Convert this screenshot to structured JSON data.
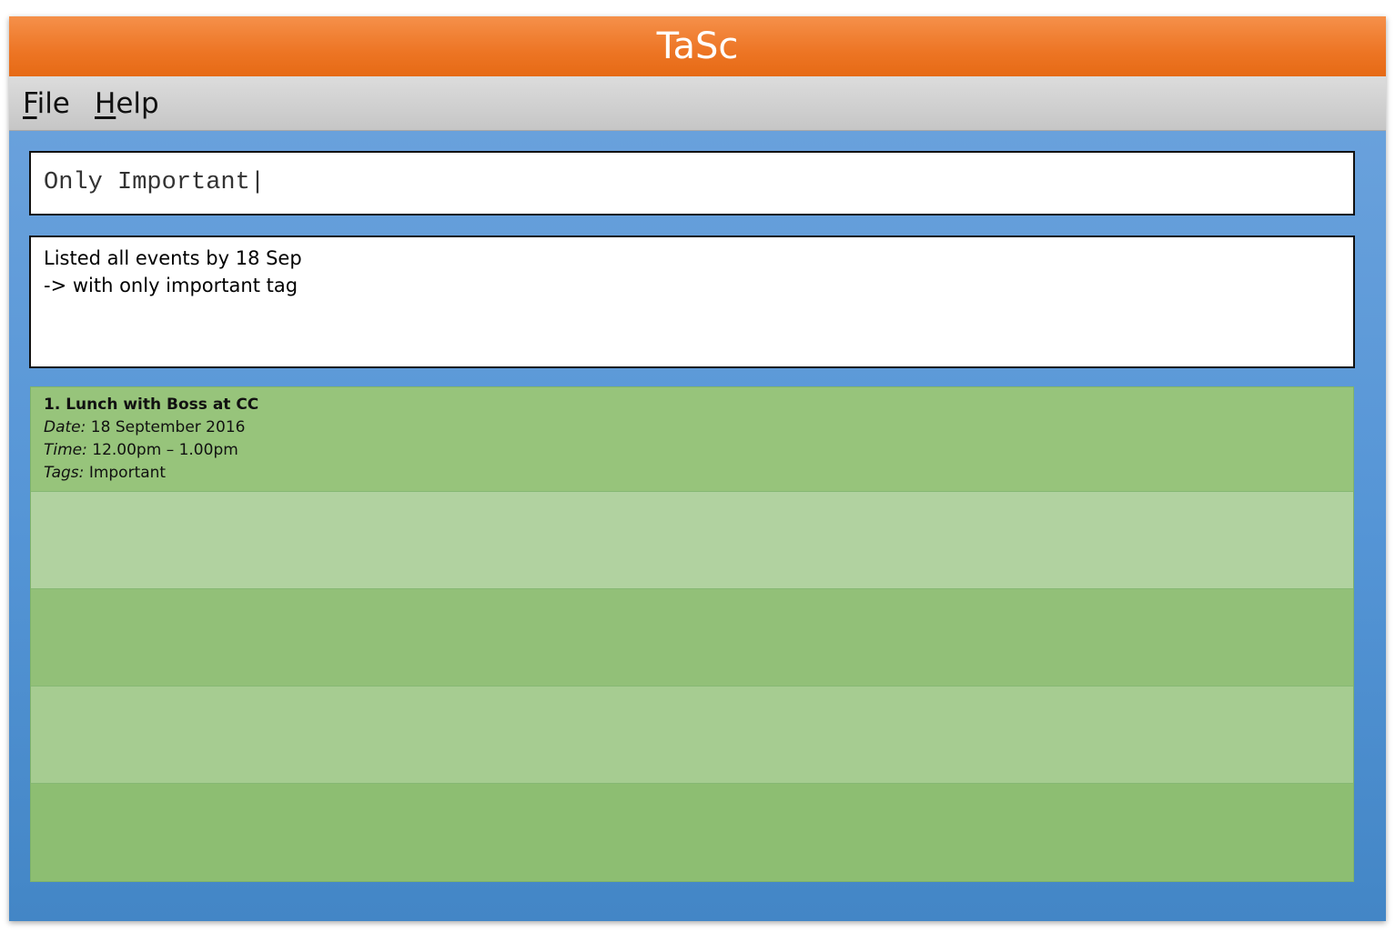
{
  "window": {
    "title": "TaSc"
  },
  "menu": {
    "file": {
      "mnemonic": "F",
      "rest": "ile"
    },
    "help": {
      "mnemonic": "H",
      "rest": "elp"
    }
  },
  "command_box": {
    "value": "Only Important|"
  },
  "result_box": {
    "lines": [
      "Listed all events by 18 Sep",
      "-> with only important tag"
    ]
  },
  "tasks": [
    {
      "title": "1. Lunch with Boss at CC",
      "date_label": "Date:",
      "date": "18 September 2016",
      "time_label": "Time:",
      "time": "12.00pm – 1.00pm",
      "tags_label": "Tags:",
      "tags": "Important"
    }
  ],
  "colors": {
    "title_bar": "#ed7524",
    "menu_bar": "#d0d0d0",
    "background": "#5595d6",
    "row_dark": "#97c47b",
    "row_light": "#b1d2a0"
  }
}
